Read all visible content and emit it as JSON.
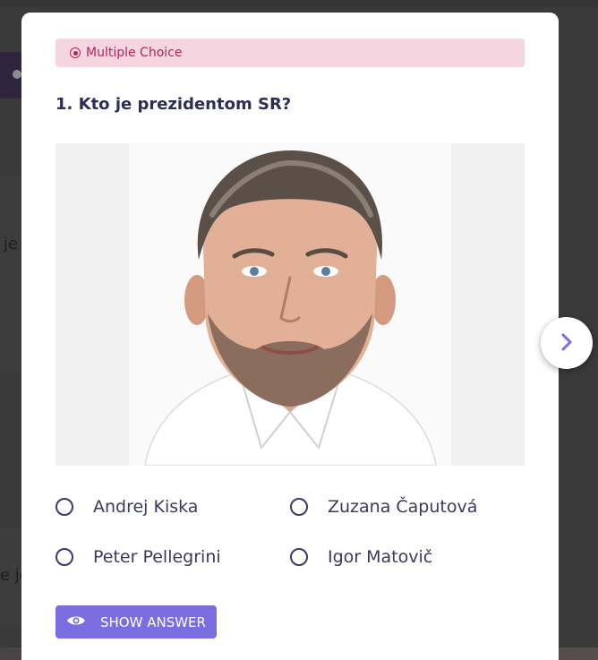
{
  "question": {
    "type_label": "Multiple Choice",
    "title": "1. Kto je prezidentom SR?",
    "options": [
      {
        "label": "Andrej Kiska"
      },
      {
        "label": "Zuzana Čaputová"
      },
      {
        "label": "Peter Pellegrini"
      },
      {
        "label": "Igor Matovič"
      }
    ]
  },
  "actions": {
    "show_answer_label": "SHOW ANSWER",
    "next_icon": "chevron-right-icon"
  },
  "background": {
    "fragment_1": "je",
    "fragment_2": "e je"
  },
  "colors": {
    "accent": "#7b6ddf",
    "badge_bg": "#f5d5df",
    "badge_text": "#b3245c",
    "question_text": "#2d2d55",
    "overlay": "#3a3a3a"
  }
}
